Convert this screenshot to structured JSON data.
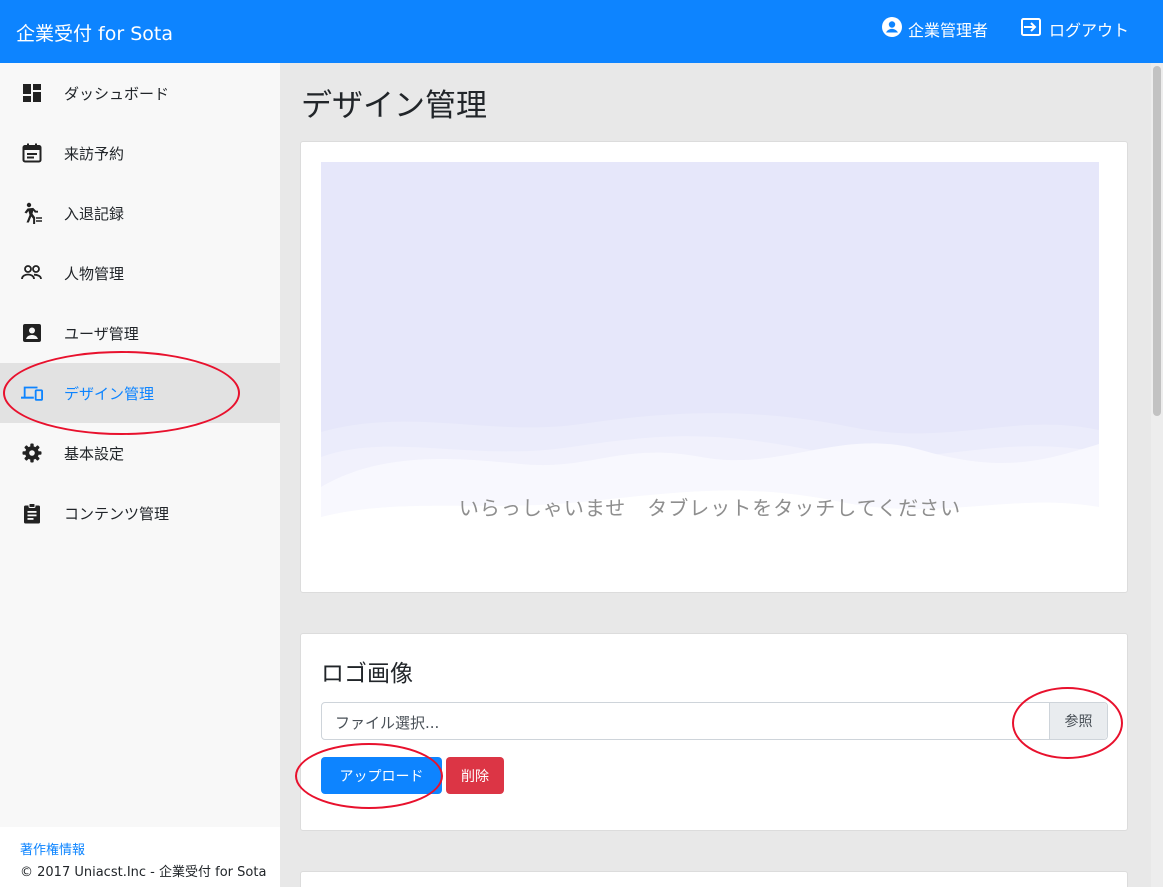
{
  "header": {
    "brand": "企業受付 for Sota",
    "user_label": "企業管理者",
    "logout_label": "ログアウト"
  },
  "sidebar": {
    "items": [
      {
        "label": "ダッシュボード",
        "icon": "dashboard-icon"
      },
      {
        "label": "来訪予約",
        "icon": "calendar-icon"
      },
      {
        "label": "入退記録",
        "icon": "walk-icon"
      },
      {
        "label": "人物管理",
        "icon": "people-icon"
      },
      {
        "label": "ユーザ管理",
        "icon": "account-box-icon"
      },
      {
        "label": "デザイン管理",
        "icon": "devices-icon",
        "active": true
      },
      {
        "label": "基本設定",
        "icon": "gear-icon"
      },
      {
        "label": "コンテンツ管理",
        "icon": "clipboard-icon"
      }
    ],
    "footer": {
      "link": "著作権情報",
      "copyright": "© 2017 Uniacst.Inc - 企業受付 for Sota"
    }
  },
  "main": {
    "title": "デザイン管理",
    "preview": {
      "text": "いらっしゃいませ　タブレットをタッチしてください"
    },
    "logo_section": {
      "title": "ロゴ画像",
      "file_placeholder": "ファイル選択...",
      "browse_label": "参照",
      "upload_label": "アップロード",
      "delete_label": "削除"
    }
  },
  "colors": {
    "accent": "#0d84ff",
    "danger": "#dc3545",
    "annotation": "#e8112d"
  }
}
